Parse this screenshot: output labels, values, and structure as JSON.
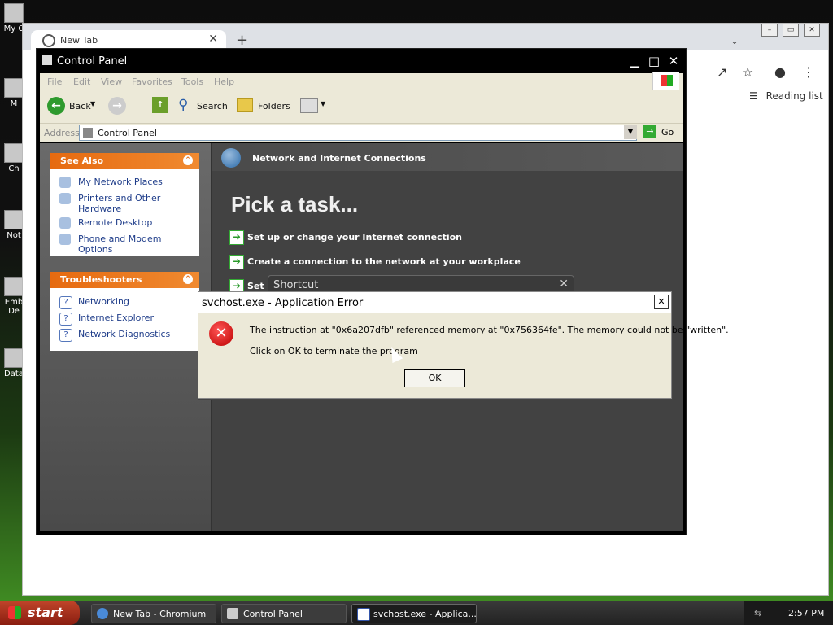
{
  "desktop": {
    "icons": [
      "My C",
      "M",
      "Ch",
      "Not",
      "Emb De",
      "Data"
    ]
  },
  "chromium": {
    "tab_title": "New Tab",
    "reading_list": "Reading list"
  },
  "control_panel": {
    "title": "Control Panel",
    "menu": [
      "File",
      "Edit",
      "View",
      "Favorites",
      "Tools",
      "Help"
    ],
    "toolbar": {
      "back": "Back",
      "search": "Search",
      "folders": "Folders"
    },
    "address": {
      "label": "Address",
      "value": "Control Panel",
      "go": "Go"
    },
    "see_also": {
      "title": "See Also",
      "items": [
        "My Network Places",
        "Printers and Other Hardware",
        "Remote Desktop",
        "Phone and Modem Options"
      ]
    },
    "troubleshooters": {
      "title": "Troubleshooters",
      "items": [
        "Networking",
        "Internet Explorer",
        "Network Diagnostics"
      ]
    },
    "category": "Network and Internet Connections",
    "pick_task": "Pick a task...",
    "tasks": [
      "Set up or change your Internet connection",
      "Create a connection to the network at your workplace",
      "Set"
    ],
    "shortcut_title": "Shortcut"
  },
  "dialog": {
    "title": "svchost.exe - Application Error",
    "message": "The instruction at \"0x6a207dfb\" referenced memory at \"0x756364fe\". The memory could not be \"written\".",
    "message2": "Click on OK to terminate the program",
    "ok": "OK"
  },
  "taskbar": {
    "start": "start",
    "items": [
      "New Tab - Chromium",
      "Control Panel",
      "svchost.exe - Applica..."
    ],
    "clock": "2:57 PM"
  }
}
